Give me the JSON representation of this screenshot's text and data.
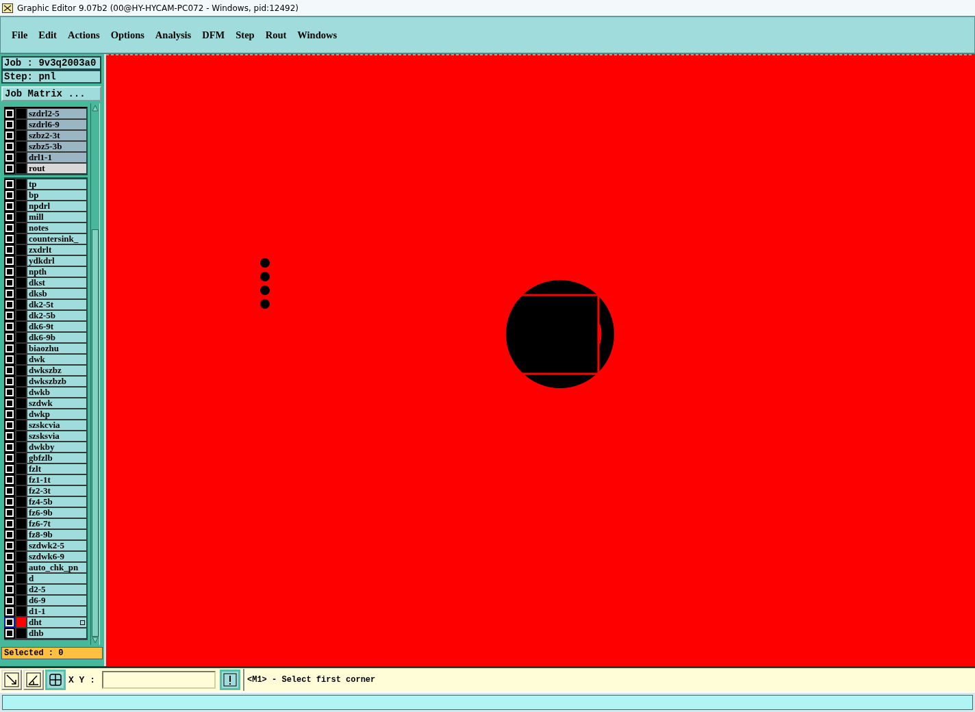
{
  "window": {
    "title": "Graphic Editor 9.07b2 (00@HY-HYCAM-PC072 - Windows, pid:12492)"
  },
  "menu": [
    "File",
    "Edit",
    "Actions",
    "Options",
    "Analysis",
    "DFM",
    "Step",
    "Rout",
    "Windows"
  ],
  "job": {
    "job_label": "Job : 9v3q2003a0",
    "step_label": "Step: pnl",
    "matrix_button": "Job Matrix ..."
  },
  "layer_groups": [
    {
      "kind": "drill",
      "layers": [
        {
          "name": "szdrl2-5",
          "kind": "drill",
          "color": "#000000",
          "active": false
        },
        {
          "name": "szdrl6-9",
          "kind": "drill",
          "color": "#000000",
          "active": false
        },
        {
          "name": "szbz2-3t",
          "kind": "drill",
          "color": "#000000",
          "active": false
        },
        {
          "name": "szbz5-3b",
          "kind": "drill",
          "color": "#000000",
          "active": false
        },
        {
          "name": "drl1-1",
          "kind": "drill",
          "color": "#000000",
          "active": false
        },
        {
          "name": "rout",
          "kind": "rout",
          "color": "#000000",
          "active": false
        }
      ]
    },
    {
      "kind": "misc",
      "layers": [
        {
          "name": "tp",
          "kind": "misc",
          "color": "#000000",
          "active": false
        },
        {
          "name": "bp",
          "kind": "misc",
          "color": "#000000",
          "active": false
        },
        {
          "name": "npdrl",
          "kind": "misc",
          "color": "#000000",
          "active": false
        },
        {
          "name": "mill",
          "kind": "misc",
          "color": "#000000",
          "active": false
        },
        {
          "name": "notes",
          "kind": "misc",
          "color": "#000000",
          "active": false
        },
        {
          "name": "countersink_",
          "kind": "misc",
          "color": "#000000",
          "active": false
        },
        {
          "name": "zxdrlt",
          "kind": "misc",
          "color": "#000000",
          "active": false
        },
        {
          "name": "ydkdrl",
          "kind": "misc",
          "color": "#000000",
          "active": false
        },
        {
          "name": "npth",
          "kind": "misc",
          "color": "#000000",
          "active": false
        },
        {
          "name": "dkst",
          "kind": "misc",
          "color": "#000000",
          "active": false
        },
        {
          "name": "dksb",
          "kind": "misc",
          "color": "#000000",
          "active": false
        },
        {
          "name": "dk2-5t",
          "kind": "misc",
          "color": "#000000",
          "active": false
        },
        {
          "name": "dk2-5b",
          "kind": "misc",
          "color": "#000000",
          "active": false
        },
        {
          "name": "dk6-9t",
          "kind": "misc",
          "color": "#000000",
          "active": false
        },
        {
          "name": "dk6-9b",
          "kind": "misc",
          "color": "#000000",
          "active": false
        },
        {
          "name": "biaozhu",
          "kind": "misc",
          "color": "#000000",
          "active": false
        },
        {
          "name": "dwk",
          "kind": "misc",
          "color": "#000000",
          "active": false
        },
        {
          "name": "dwkszbz",
          "kind": "misc",
          "color": "#000000",
          "active": false
        },
        {
          "name": "dwkszbzb",
          "kind": "misc",
          "color": "#000000",
          "active": false
        },
        {
          "name": "dwkb",
          "kind": "misc",
          "color": "#000000",
          "active": false
        },
        {
          "name": "szdwk",
          "kind": "misc",
          "color": "#000000",
          "active": false
        },
        {
          "name": "dwkp",
          "kind": "misc",
          "color": "#000000",
          "active": false
        },
        {
          "name": "szskcvia",
          "kind": "misc",
          "color": "#000000",
          "active": false
        },
        {
          "name": "szsksvia",
          "kind": "misc",
          "color": "#000000",
          "active": false
        },
        {
          "name": "dwkby",
          "kind": "misc",
          "color": "#000000",
          "active": false
        },
        {
          "name": "gbfzlb",
          "kind": "misc",
          "color": "#000000",
          "active": false
        },
        {
          "name": "fzlt",
          "kind": "misc",
          "color": "#000000",
          "active": false
        },
        {
          "name": "fz1-1t",
          "kind": "misc",
          "color": "#000000",
          "active": false
        },
        {
          "name": "fz2-3t",
          "kind": "misc",
          "color": "#000000",
          "active": false
        },
        {
          "name": "fz4-5b",
          "kind": "misc",
          "color": "#000000",
          "active": false
        },
        {
          "name": "fz6-9b",
          "kind": "misc",
          "color": "#000000",
          "active": false
        },
        {
          "name": "fz6-7t",
          "kind": "misc",
          "color": "#000000",
          "active": false
        },
        {
          "name": "fz8-9b",
          "kind": "misc",
          "color": "#000000",
          "active": false
        },
        {
          "name": "szdwk2-5",
          "kind": "misc",
          "color": "#000000",
          "active": false
        },
        {
          "name": "szdwk6-9",
          "kind": "misc",
          "color": "#000000",
          "active": false
        },
        {
          "name": "auto_chk_pn",
          "kind": "misc",
          "color": "#000000",
          "active": false
        },
        {
          "name": "d",
          "kind": "misc",
          "color": "#000000",
          "active": false
        },
        {
          "name": "d2-5",
          "kind": "misc",
          "color": "#000000",
          "active": false
        },
        {
          "name": "d6-9",
          "kind": "misc",
          "color": "#000000",
          "active": false
        },
        {
          "name": "d1-1",
          "kind": "misc",
          "color": "#000000",
          "active": false
        },
        {
          "name": "dht",
          "kind": "misc",
          "color": "#ff0000",
          "active": true
        },
        {
          "name": "dhb",
          "kind": "misc",
          "color": "#000000",
          "active": false
        }
      ]
    }
  ],
  "selected_count": "Selected : 0",
  "toolbar": {
    "xy_label": "X Y :",
    "message": "<M1> - Select first corner"
  }
}
